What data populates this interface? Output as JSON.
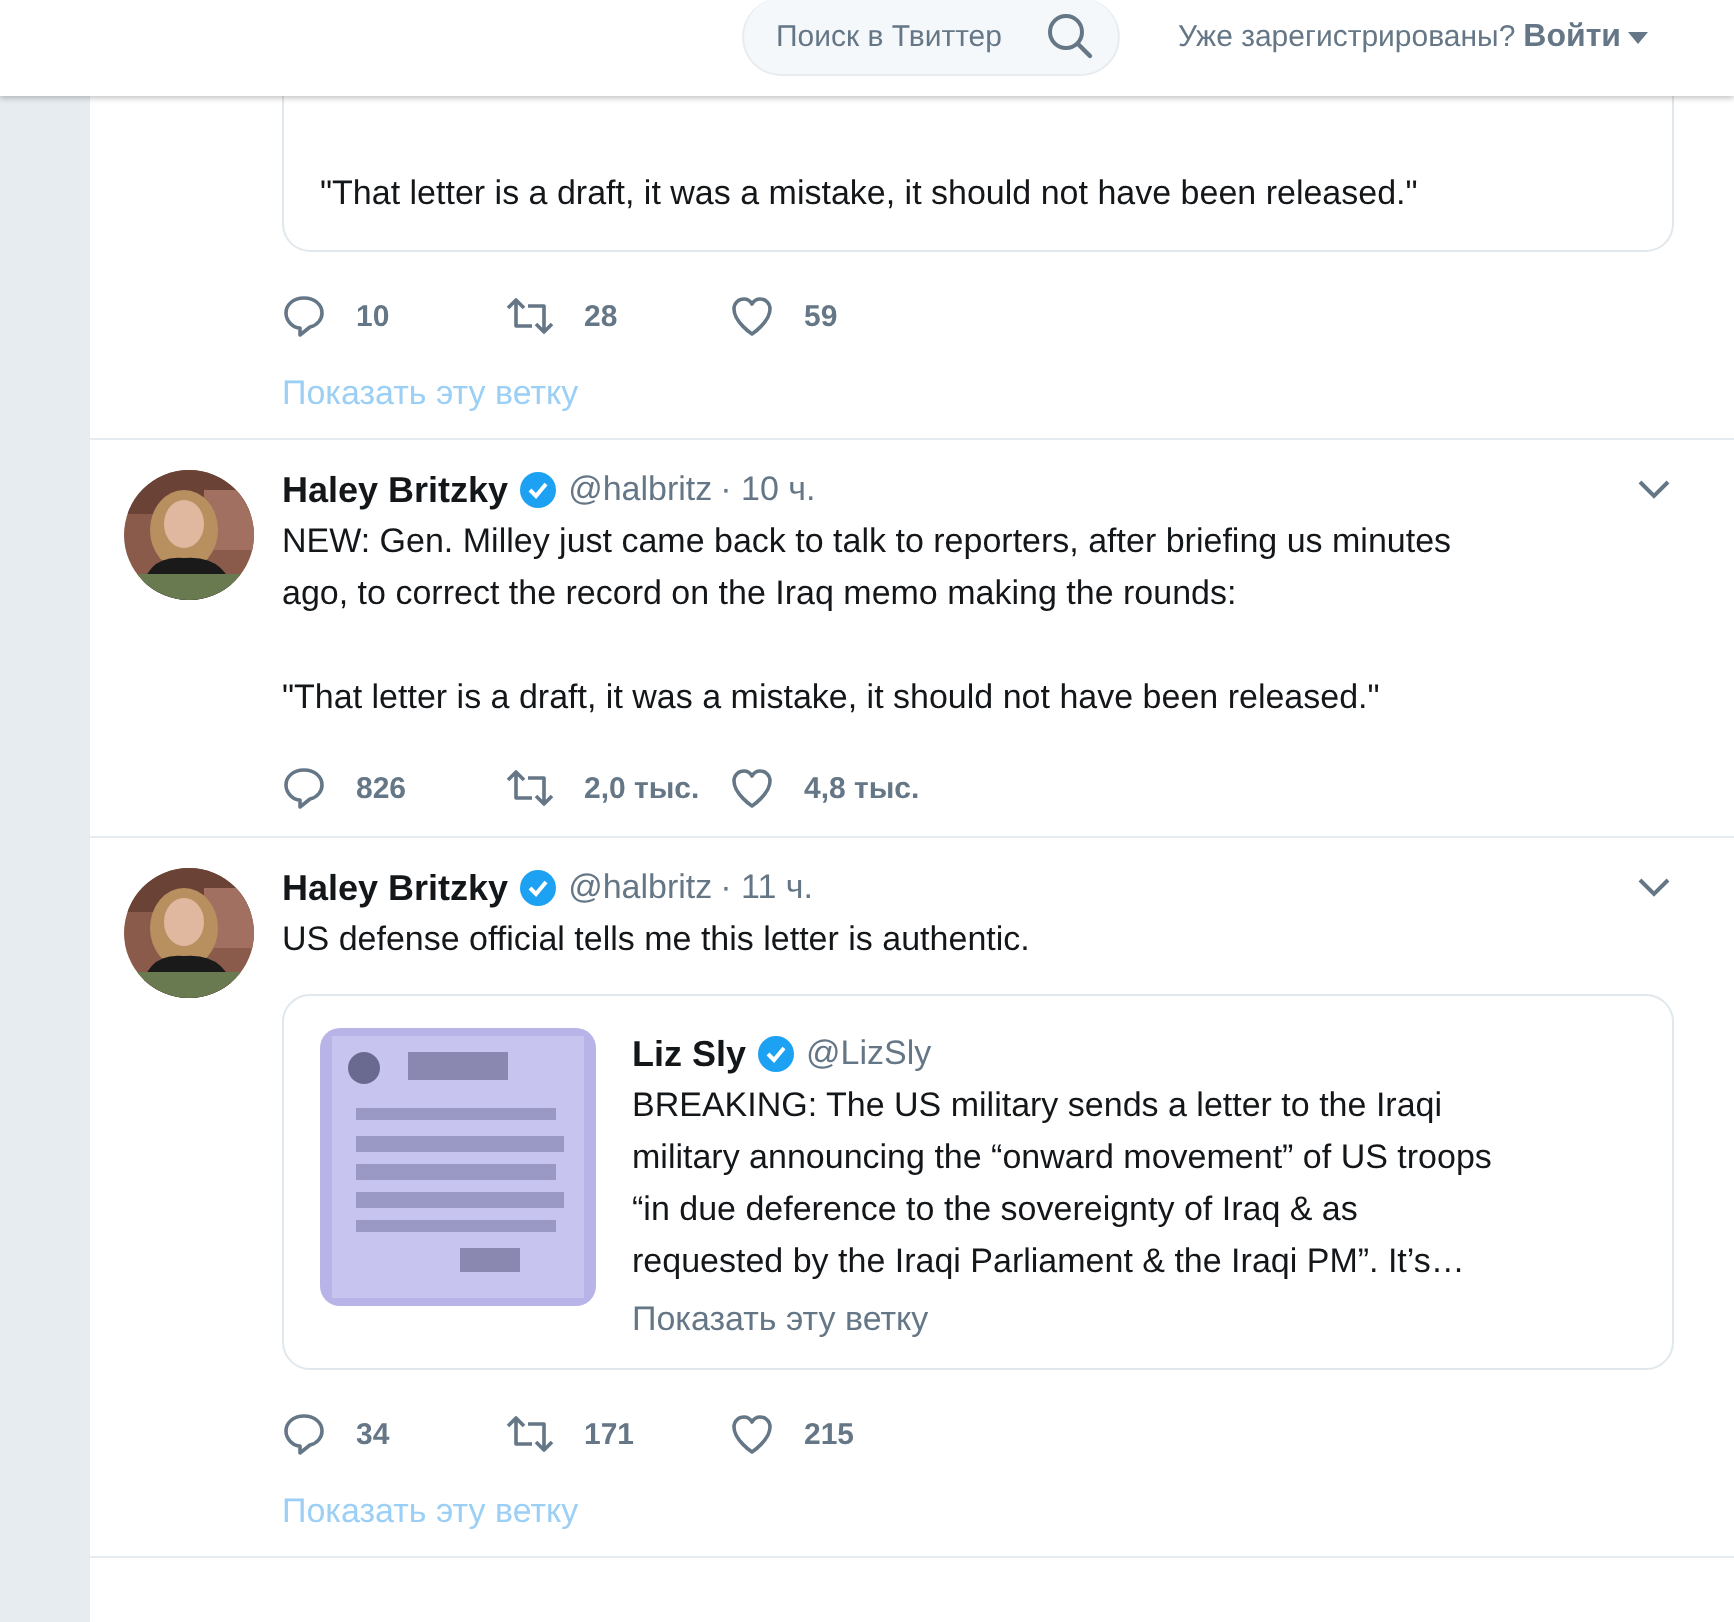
{
  "header": {
    "search": {
      "placeholder": "Поиск в Твиттер"
    },
    "login_prompt": "Уже зарегистрированы?",
    "login_button": "Войти"
  },
  "tweets": [
    {
      "quote": {
        "text": "\"That letter is a draft, it was a mistake, it should not have been released.\""
      },
      "replies": "10",
      "retweets": "28",
      "likes": "59",
      "thread_link": "Показать эту ветку"
    },
    {
      "author": {
        "name": "Haley Britzky",
        "verified": true,
        "handle": "@halbritz",
        "time": "· 10 ч."
      },
      "text": "NEW: Gen. Milley just came back to talk to reporters, after briefing us minutes\nago, to correct the record on the Iraq memo making the rounds:\n\n\"That letter is a draft, it was a mistake, it should not have been released.\"",
      "replies": "826",
      "retweets": "2,0 тыс.",
      "likes": "4,8 тыс."
    },
    {
      "author": {
        "name": "Haley Britzky",
        "verified": true,
        "handle": "@halbritz",
        "time": "· 11 ч."
      },
      "text": "US defense official tells me this letter is authentic.",
      "quote": {
        "author": {
          "name": "Liz Sly",
          "verified": true,
          "handle": "@LizSly"
        },
        "text": "BREAKING: The US military sends a letter to the Iraqi\nmilitary announcing the “onward movement” of US troops\n“in due deference to the sovereignty of Iraq & as\nrequested by the Iraqi Parliament & the Iraqi PM”. It’s…",
        "thread_link": "Показать эту ветку"
      },
      "replies": "34",
      "retweets": "171",
      "likes": "215",
      "thread_link": "Показать эту ветку"
    }
  ]
}
